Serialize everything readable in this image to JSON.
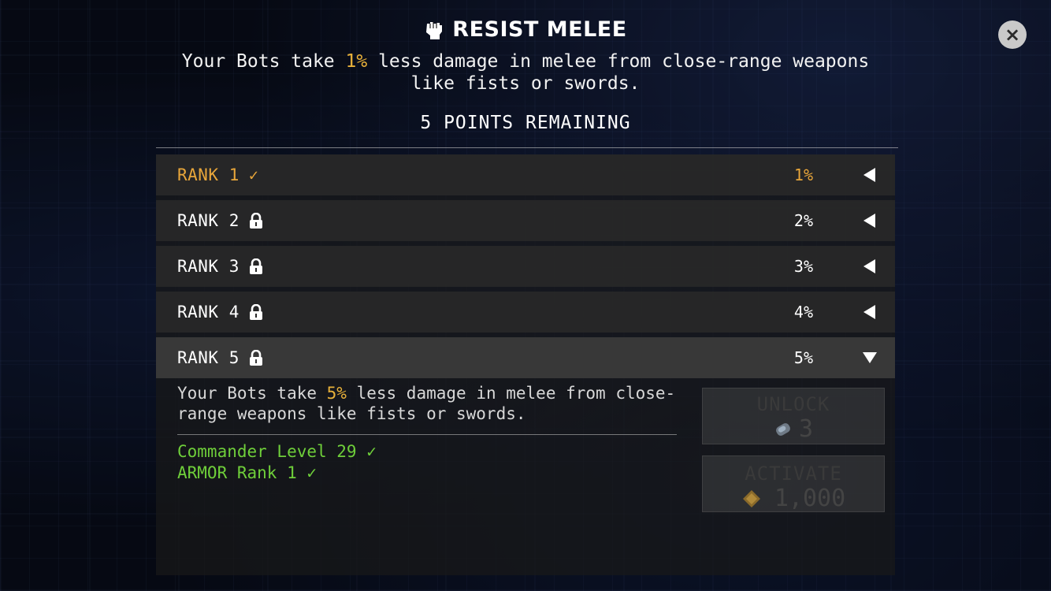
{
  "header": {
    "title": "RESIST MELEE",
    "icon": "fist-icon",
    "description_before": "Your Bots take ",
    "description_value": "1%",
    "description_after": " less damage in melee from close-range weapons like fists or swords.",
    "points_remaining": "5 POINTS REMAINING"
  },
  "close_button": {
    "icon": "close-icon",
    "label": "×"
  },
  "ranks": [
    {
      "label": "RANK 1",
      "status": "✓",
      "value": "1%",
      "state": "active"
    },
    {
      "label": "RANK 2",
      "status": "locked",
      "value": "2%",
      "state": "locked"
    },
    {
      "label": "RANK 3",
      "status": "locked",
      "value": "3%",
      "state": "locked"
    },
    {
      "label": "RANK 4",
      "status": "locked",
      "value": "4%",
      "state": "locked"
    },
    {
      "label": "RANK 5",
      "status": "locked",
      "value": "5%",
      "state": "expanded"
    }
  ],
  "detail": {
    "description_before": "Your Bots take ",
    "description_value": "5%",
    "description_after": " less damage in melee from close-range weapons like fists or swords.",
    "requirements": [
      "Commander Level 29 ✓",
      "ARMOR Rank 1 ✓"
    ]
  },
  "unlock_button": {
    "label": "UNLOCK",
    "cost": "3",
    "icon": "bolt-canister-icon"
  },
  "activate_button": {
    "label": "ACTIVATE",
    "cost": "1,000",
    "icon": "gold-crystal-icon"
  },
  "colors": {
    "accent": "#e8a63a",
    "requirement_met": "#6fcf3a",
    "row_bg": "#282828"
  }
}
